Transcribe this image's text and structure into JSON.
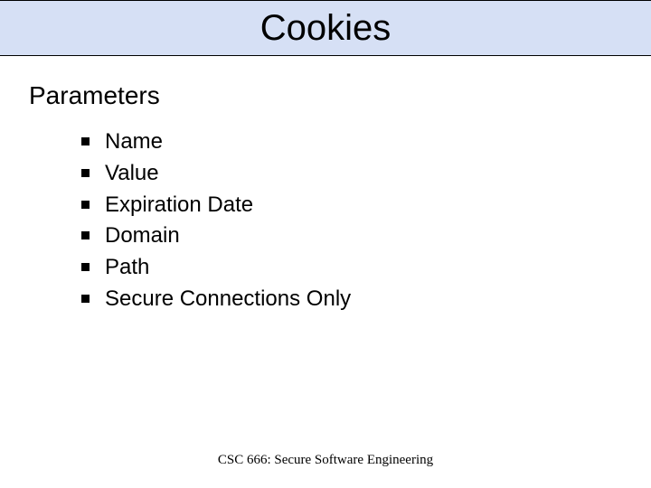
{
  "title": "Cookies",
  "section_heading": "Parameters",
  "bullets": {
    "0": "Name",
    "1": "Value",
    "2": "Expiration Date",
    "3": "Domain",
    "4": "Path",
    "5": "Secure Connections Only"
  },
  "footer": "CSC 666: Secure Software Engineering"
}
